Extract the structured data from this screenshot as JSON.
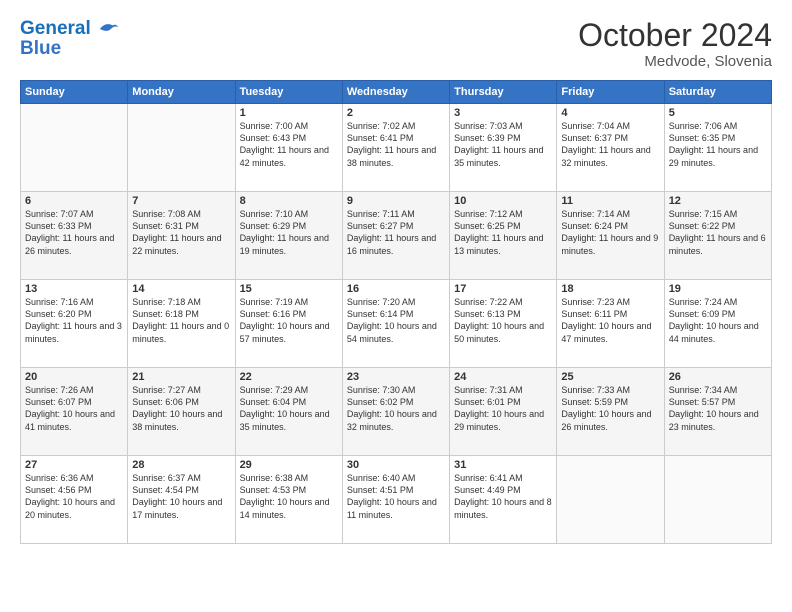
{
  "header": {
    "logo_line1": "General",
    "logo_line2": "Blue",
    "month": "October 2024",
    "location": "Medvode, Slovenia"
  },
  "weekdays": [
    "Sunday",
    "Monday",
    "Tuesday",
    "Wednesday",
    "Thursday",
    "Friday",
    "Saturday"
  ],
  "weeks": [
    [
      {
        "day": "",
        "content": ""
      },
      {
        "day": "",
        "content": ""
      },
      {
        "day": "1",
        "content": "Sunrise: 7:00 AM\nSunset: 6:43 PM\nDaylight: 11 hours\nand 42 minutes."
      },
      {
        "day": "2",
        "content": "Sunrise: 7:02 AM\nSunset: 6:41 PM\nDaylight: 11 hours\nand 38 minutes."
      },
      {
        "day": "3",
        "content": "Sunrise: 7:03 AM\nSunset: 6:39 PM\nDaylight: 11 hours\nand 35 minutes."
      },
      {
        "day": "4",
        "content": "Sunrise: 7:04 AM\nSunset: 6:37 PM\nDaylight: 11 hours\nand 32 minutes."
      },
      {
        "day": "5",
        "content": "Sunrise: 7:06 AM\nSunset: 6:35 PM\nDaylight: 11 hours\nand 29 minutes."
      }
    ],
    [
      {
        "day": "6",
        "content": "Sunrise: 7:07 AM\nSunset: 6:33 PM\nDaylight: 11 hours\nand 26 minutes."
      },
      {
        "day": "7",
        "content": "Sunrise: 7:08 AM\nSunset: 6:31 PM\nDaylight: 11 hours\nand 22 minutes."
      },
      {
        "day": "8",
        "content": "Sunrise: 7:10 AM\nSunset: 6:29 PM\nDaylight: 11 hours\nand 19 minutes."
      },
      {
        "day": "9",
        "content": "Sunrise: 7:11 AM\nSunset: 6:27 PM\nDaylight: 11 hours\nand 16 minutes."
      },
      {
        "day": "10",
        "content": "Sunrise: 7:12 AM\nSunset: 6:25 PM\nDaylight: 11 hours\nand 13 minutes."
      },
      {
        "day": "11",
        "content": "Sunrise: 7:14 AM\nSunset: 6:24 PM\nDaylight: 11 hours\nand 9 minutes."
      },
      {
        "day": "12",
        "content": "Sunrise: 7:15 AM\nSunset: 6:22 PM\nDaylight: 11 hours\nand 6 minutes."
      }
    ],
    [
      {
        "day": "13",
        "content": "Sunrise: 7:16 AM\nSunset: 6:20 PM\nDaylight: 11 hours\nand 3 minutes."
      },
      {
        "day": "14",
        "content": "Sunrise: 7:18 AM\nSunset: 6:18 PM\nDaylight: 11 hours\nand 0 minutes."
      },
      {
        "day": "15",
        "content": "Sunrise: 7:19 AM\nSunset: 6:16 PM\nDaylight: 10 hours\nand 57 minutes."
      },
      {
        "day": "16",
        "content": "Sunrise: 7:20 AM\nSunset: 6:14 PM\nDaylight: 10 hours\nand 54 minutes."
      },
      {
        "day": "17",
        "content": "Sunrise: 7:22 AM\nSunset: 6:13 PM\nDaylight: 10 hours\nand 50 minutes."
      },
      {
        "day": "18",
        "content": "Sunrise: 7:23 AM\nSunset: 6:11 PM\nDaylight: 10 hours\nand 47 minutes."
      },
      {
        "day": "19",
        "content": "Sunrise: 7:24 AM\nSunset: 6:09 PM\nDaylight: 10 hours\nand 44 minutes."
      }
    ],
    [
      {
        "day": "20",
        "content": "Sunrise: 7:26 AM\nSunset: 6:07 PM\nDaylight: 10 hours\nand 41 minutes."
      },
      {
        "day": "21",
        "content": "Sunrise: 7:27 AM\nSunset: 6:06 PM\nDaylight: 10 hours\nand 38 minutes."
      },
      {
        "day": "22",
        "content": "Sunrise: 7:29 AM\nSunset: 6:04 PM\nDaylight: 10 hours\nand 35 minutes."
      },
      {
        "day": "23",
        "content": "Sunrise: 7:30 AM\nSunset: 6:02 PM\nDaylight: 10 hours\nand 32 minutes."
      },
      {
        "day": "24",
        "content": "Sunrise: 7:31 AM\nSunset: 6:01 PM\nDaylight: 10 hours\nand 29 minutes."
      },
      {
        "day": "25",
        "content": "Sunrise: 7:33 AM\nSunset: 5:59 PM\nDaylight: 10 hours\nand 26 minutes."
      },
      {
        "day": "26",
        "content": "Sunrise: 7:34 AM\nSunset: 5:57 PM\nDaylight: 10 hours\nand 23 minutes."
      }
    ],
    [
      {
        "day": "27",
        "content": "Sunrise: 6:36 AM\nSunset: 4:56 PM\nDaylight: 10 hours\nand 20 minutes."
      },
      {
        "day": "28",
        "content": "Sunrise: 6:37 AM\nSunset: 4:54 PM\nDaylight: 10 hours\nand 17 minutes."
      },
      {
        "day": "29",
        "content": "Sunrise: 6:38 AM\nSunset: 4:53 PM\nDaylight: 10 hours\nand 14 minutes."
      },
      {
        "day": "30",
        "content": "Sunrise: 6:40 AM\nSunset: 4:51 PM\nDaylight: 10 hours\nand 11 minutes."
      },
      {
        "day": "31",
        "content": "Sunrise: 6:41 AM\nSunset: 4:49 PM\nDaylight: 10 hours\nand 8 minutes."
      },
      {
        "day": "",
        "content": ""
      },
      {
        "day": "",
        "content": ""
      }
    ]
  ]
}
